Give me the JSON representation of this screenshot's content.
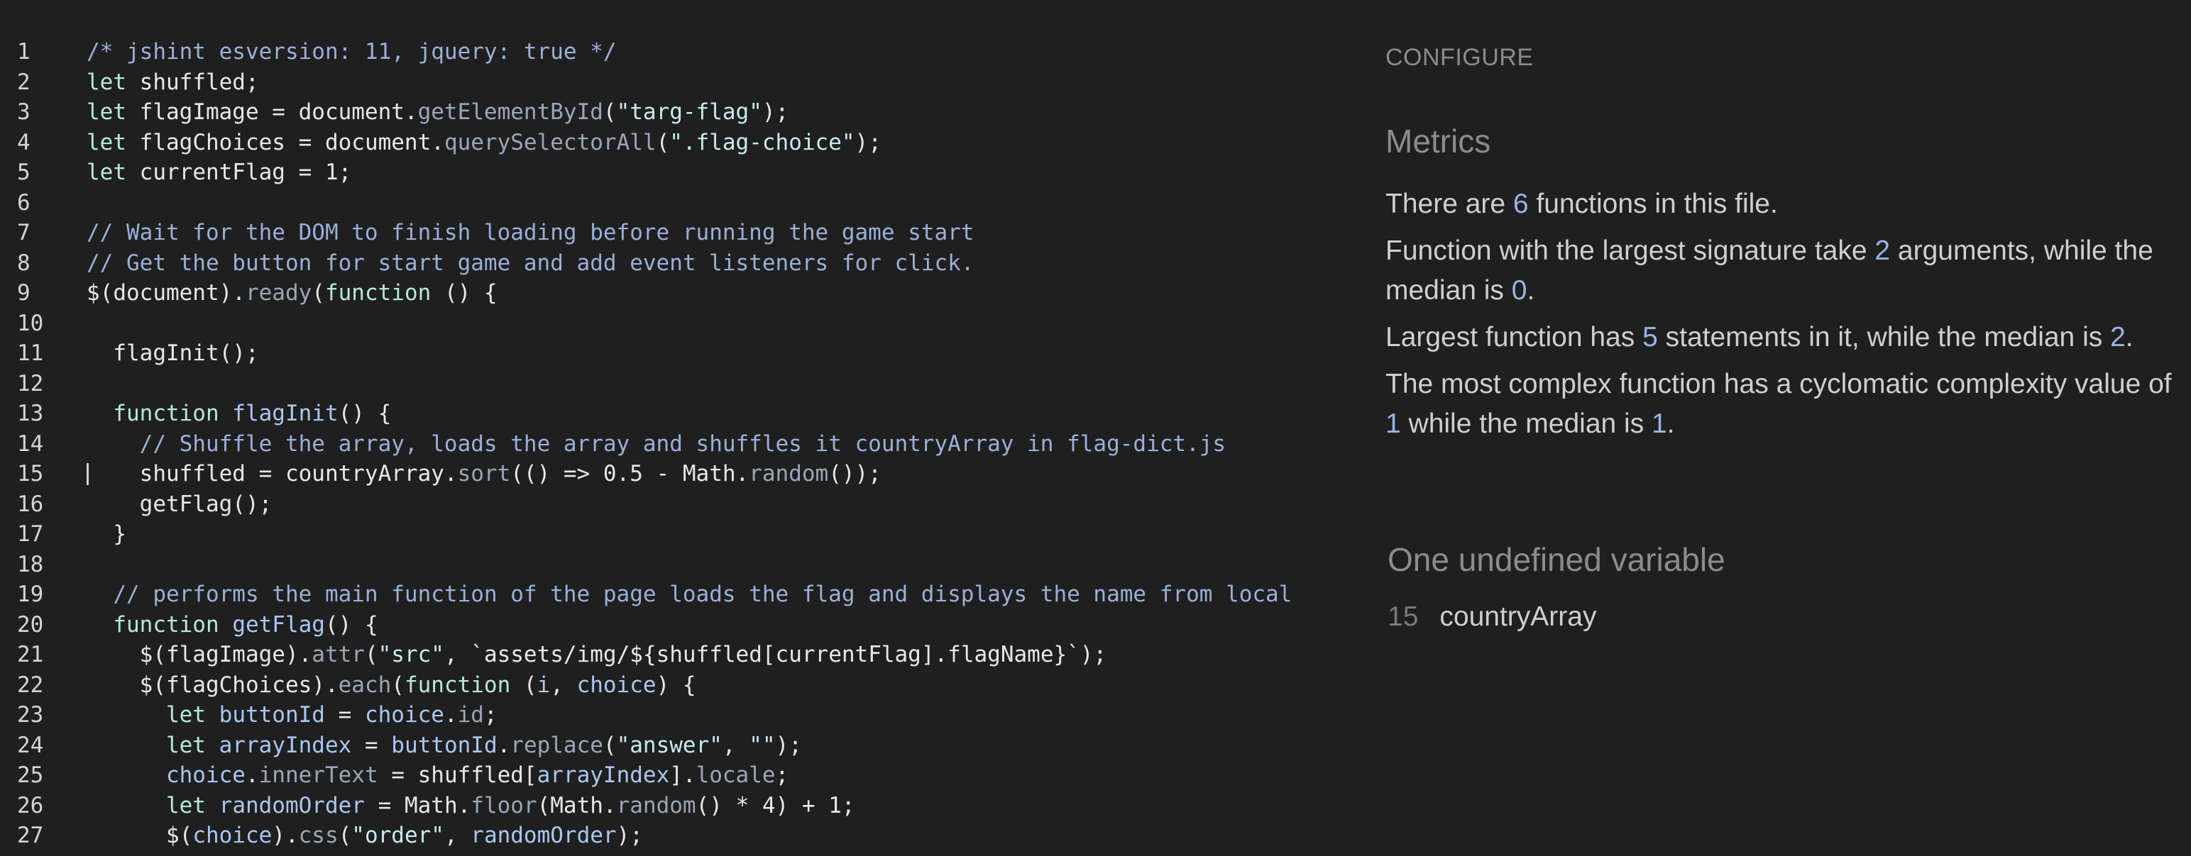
{
  "editor": {
    "cursor_line": 15,
    "lines": [
      {
        "n": "1",
        "indent": "",
        "tokens": [
          {
            "t": "/* jshint esversion: 11, jquery: true */",
            "c": "com"
          }
        ]
      },
      {
        "n": "2",
        "indent": "",
        "tokens": [
          {
            "t": "let",
            "c": "kw"
          },
          {
            "t": " shuffled;",
            "c": "plain"
          }
        ]
      },
      {
        "n": "3",
        "indent": "",
        "tokens": [
          {
            "t": "let",
            "c": "kw"
          },
          {
            "t": " flagImage = document.",
            "c": "plain"
          },
          {
            "t": "getElementById",
            "c": "meth"
          },
          {
            "t": "(",
            "c": "plain"
          },
          {
            "t": "\"targ-flag\"",
            "c": "str"
          },
          {
            "t": ");",
            "c": "plain"
          }
        ]
      },
      {
        "n": "4",
        "indent": "",
        "tokens": [
          {
            "t": "let",
            "c": "kw"
          },
          {
            "t": " flagChoices = document.",
            "c": "plain"
          },
          {
            "t": "querySelectorAll",
            "c": "meth"
          },
          {
            "t": "(",
            "c": "plain"
          },
          {
            "t": "\".flag-choice\"",
            "c": "str"
          },
          {
            "t": ");",
            "c": "plain"
          }
        ]
      },
      {
        "n": "5",
        "indent": "",
        "tokens": [
          {
            "t": "let",
            "c": "kw"
          },
          {
            "t": " currentFlag = 1;",
            "c": "plain"
          }
        ]
      },
      {
        "n": "6",
        "indent": "",
        "tokens": []
      },
      {
        "n": "7",
        "indent": "",
        "tokens": [
          {
            "t": "// Wait for the DOM to finish loading before running the game start",
            "c": "com"
          }
        ]
      },
      {
        "n": "8",
        "indent": "",
        "tokens": [
          {
            "t": "// Get the button for start game and add event listeners for click.",
            "c": "com"
          }
        ]
      },
      {
        "n": "9",
        "indent": "",
        "tokens": [
          {
            "t": "$(document).",
            "c": "plain"
          },
          {
            "t": "ready",
            "c": "meth"
          },
          {
            "t": "(",
            "c": "plain"
          },
          {
            "t": "function",
            "c": "kw"
          },
          {
            "t": " () {",
            "c": "plain"
          }
        ]
      },
      {
        "n": "10",
        "indent": "",
        "tokens": []
      },
      {
        "n": "11",
        "indent": "  ",
        "tokens": [
          {
            "t": "flagInit();",
            "c": "plain"
          }
        ]
      },
      {
        "n": "12",
        "indent": "",
        "tokens": []
      },
      {
        "n": "13",
        "indent": "  ",
        "tokens": [
          {
            "t": "function",
            "c": "kw"
          },
          {
            "t": " ",
            "c": "plain"
          },
          {
            "t": "flagInit",
            "c": "var"
          },
          {
            "t": "() {",
            "c": "plain"
          }
        ]
      },
      {
        "n": "14",
        "indent": "    ",
        "tokens": [
          {
            "t": "// Shuffle the array, loads the array and shuffles it countryArray in flag-dict.js",
            "c": "com"
          }
        ]
      },
      {
        "n": "15",
        "indent": "    ",
        "tokens": [
          {
            "t": "shuffled = countryArray.",
            "c": "plain"
          },
          {
            "t": "sort",
            "c": "meth"
          },
          {
            "t": "(() => 0.5 - Math.",
            "c": "plain"
          },
          {
            "t": "random",
            "c": "meth"
          },
          {
            "t": "());",
            "c": "plain"
          }
        ]
      },
      {
        "n": "16",
        "indent": "    ",
        "tokens": [
          {
            "t": "getFlag();",
            "c": "plain"
          }
        ]
      },
      {
        "n": "17",
        "indent": "  ",
        "tokens": [
          {
            "t": "}",
            "c": "plain"
          }
        ]
      },
      {
        "n": "18",
        "indent": "",
        "tokens": []
      },
      {
        "n": "19",
        "indent": "  ",
        "tokens": [
          {
            "t": "// performs the main function of the page loads the flag and displays the name from local",
            "c": "com"
          }
        ]
      },
      {
        "n": "20",
        "indent": "  ",
        "tokens": [
          {
            "t": "function",
            "c": "kw"
          },
          {
            "t": " ",
            "c": "plain"
          },
          {
            "t": "getFlag",
            "c": "var"
          },
          {
            "t": "() {",
            "c": "plain"
          }
        ]
      },
      {
        "n": "21",
        "indent": "    ",
        "tokens": [
          {
            "t": "$(flagImage).",
            "c": "plain"
          },
          {
            "t": "attr",
            "c": "meth"
          },
          {
            "t": "(",
            "c": "plain"
          },
          {
            "t": "\"src\"",
            "c": "str"
          },
          {
            "t": ", `assets/img/${shuffled[currentFlag].flagName}`);",
            "c": "plain"
          }
        ]
      },
      {
        "n": "22",
        "indent": "    ",
        "tokens": [
          {
            "t": "$(flagChoices).",
            "c": "plain"
          },
          {
            "t": "each",
            "c": "meth"
          },
          {
            "t": "(",
            "c": "plain"
          },
          {
            "t": "function",
            "c": "kw"
          },
          {
            "t": " (",
            "c": "plain"
          },
          {
            "t": "i",
            "c": "var"
          },
          {
            "t": ", ",
            "c": "plain"
          },
          {
            "t": "choice",
            "c": "var"
          },
          {
            "t": ") {",
            "c": "plain"
          }
        ]
      },
      {
        "n": "23",
        "indent": "      ",
        "tokens": [
          {
            "t": "let",
            "c": "kw"
          },
          {
            "t": " ",
            "c": "plain"
          },
          {
            "t": "buttonId",
            "c": "var"
          },
          {
            "t": " = ",
            "c": "plain"
          },
          {
            "t": "choice",
            "c": "var"
          },
          {
            "t": ".",
            "c": "plain"
          },
          {
            "t": "id",
            "c": "meth"
          },
          {
            "t": ";",
            "c": "plain"
          }
        ]
      },
      {
        "n": "24",
        "indent": "      ",
        "tokens": [
          {
            "t": "let",
            "c": "kw"
          },
          {
            "t": " ",
            "c": "plain"
          },
          {
            "t": "arrayIndex",
            "c": "var"
          },
          {
            "t": " = ",
            "c": "plain"
          },
          {
            "t": "buttonId",
            "c": "var"
          },
          {
            "t": ".",
            "c": "plain"
          },
          {
            "t": "replace",
            "c": "meth"
          },
          {
            "t": "(",
            "c": "plain"
          },
          {
            "t": "\"answer\"",
            "c": "str"
          },
          {
            "t": ", ",
            "c": "plain"
          },
          {
            "t": "\"\"",
            "c": "str"
          },
          {
            "t": ");",
            "c": "plain"
          }
        ]
      },
      {
        "n": "25",
        "indent": "      ",
        "tokens": [
          {
            "t": "choice",
            "c": "var"
          },
          {
            "t": ".",
            "c": "plain"
          },
          {
            "t": "innerText",
            "c": "meth"
          },
          {
            "t": " = shuffled[",
            "c": "plain"
          },
          {
            "t": "arrayIndex",
            "c": "var"
          },
          {
            "t": "].",
            "c": "plain"
          },
          {
            "t": "locale",
            "c": "meth"
          },
          {
            "t": ";",
            "c": "plain"
          }
        ]
      },
      {
        "n": "26",
        "indent": "      ",
        "tokens": [
          {
            "t": "let",
            "c": "kw"
          },
          {
            "t": " ",
            "c": "plain"
          },
          {
            "t": "randomOrder",
            "c": "var"
          },
          {
            "t": " = Math.",
            "c": "plain"
          },
          {
            "t": "floor",
            "c": "meth"
          },
          {
            "t": "(Math.",
            "c": "plain"
          },
          {
            "t": "random",
            "c": "meth"
          },
          {
            "t": "() * 4) + 1;",
            "c": "plain"
          }
        ]
      },
      {
        "n": "27",
        "indent": "      ",
        "tokens": [
          {
            "t": "$(",
            "c": "plain"
          },
          {
            "t": "choice",
            "c": "var"
          },
          {
            "t": ").",
            "c": "plain"
          },
          {
            "t": "css",
            "c": "meth"
          },
          {
            "t": "(",
            "c": "plain"
          },
          {
            "t": "\"order\"",
            "c": "str"
          },
          {
            "t": ", ",
            "c": "plain"
          },
          {
            "t": "randomOrder",
            "c": "var"
          },
          {
            "t": ");",
            "c": "plain"
          }
        ]
      }
    ]
  },
  "side": {
    "configure_label": "CONFIGURE",
    "metrics_title": "Metrics",
    "metrics": {
      "m1": {
        "a": "There are ",
        "n1": "6",
        "b": " functions in this file.",
        "n2": "",
        "c": ""
      },
      "m2": {
        "a": "Function with the largest signature take ",
        "n1": "2",
        "b": " arguments, while the median is ",
        "n2": "0",
        "c": "."
      },
      "m3": {
        "a": "Largest function has ",
        "n1": "5",
        "b": " statements in it, while the median is ",
        "n2": "2",
        "c": "."
      },
      "m4": {
        "a": "The most complex function has a cyclomatic complexity value of ",
        "n1": "1",
        "b": " while the median is ",
        "n2": "1",
        "c": "."
      }
    },
    "undefined_title": "One undefined variable",
    "undefined_vars": [
      {
        "line": "15",
        "name": "countryArray"
      }
    ]
  },
  "colors": {
    "background": "#1f1f1f",
    "keyword": "#b5ead7",
    "comment": "#9ab0d9",
    "string": "#c8eaf0",
    "method": "#9aa7ba",
    "variable": "#aac7f0",
    "metric_number": "#9ab4e6",
    "heading_gray": "#8c8c8c"
  }
}
